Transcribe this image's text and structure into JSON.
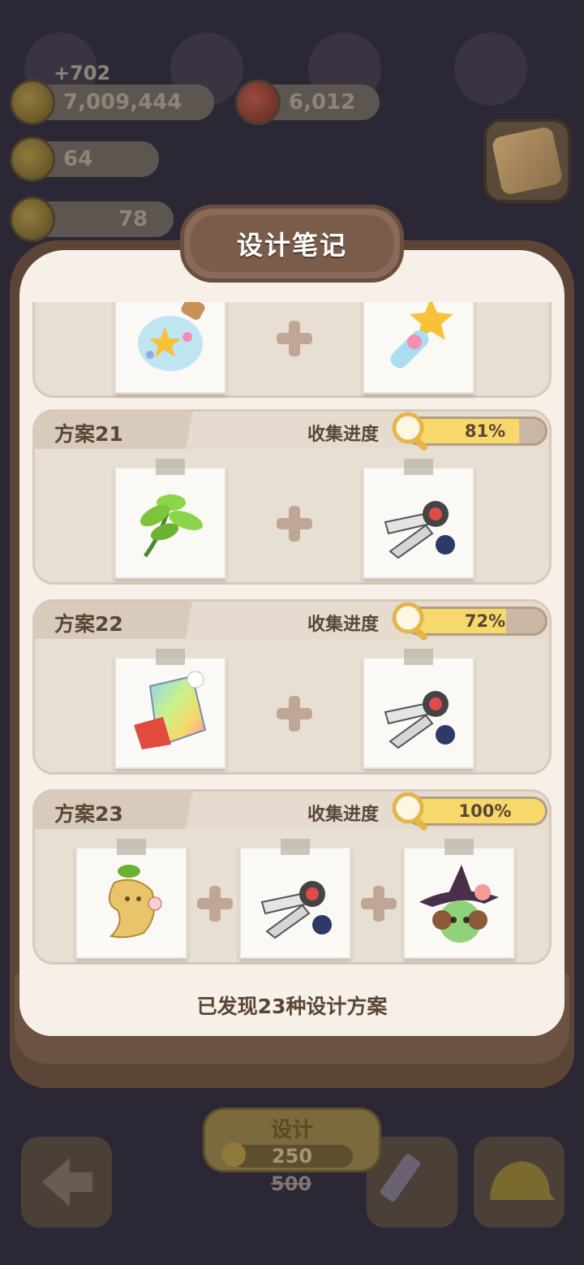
{
  "hud": {
    "delta": "+702",
    "coins": "7,009,444",
    "gems": "6,012",
    "flowers": "64",
    "hidden_count": "78"
  },
  "panel": {
    "title": "设计笔记",
    "footer": "已发现23种设计方案"
  },
  "plans": [
    {
      "name": "",
      "progress_label": "",
      "progress": "",
      "progress_fraction": 1.0,
      "items": [
        "star-jar",
        "star-wand"
      ]
    },
    {
      "name": "方案21",
      "progress_label": "收集进度",
      "progress": "81%",
      "progress_fraction": 0.81,
      "items": [
        "green-herb",
        "scissors"
      ]
    },
    {
      "name": "方案22",
      "progress_label": "收集进度",
      "progress": "72%",
      "progress_fraction": 0.72,
      "items": [
        "rainbow-bag",
        "scissors"
      ]
    },
    {
      "name": "方案23",
      "progress_label": "收集进度",
      "progress": "100%",
      "progress_fraction": 1.0,
      "items": [
        "mandrake",
        "scissors",
        "witch-girl"
      ]
    }
  ],
  "bottom": {
    "design_label": "设计",
    "cost": "250",
    "old_cost": "500"
  },
  "colors": {
    "panel_bg": "#f6f0e8",
    "card_bg": "#e8dfd4",
    "progress_fill": "#f7d86a",
    "text_brown": "#5a4636"
  }
}
